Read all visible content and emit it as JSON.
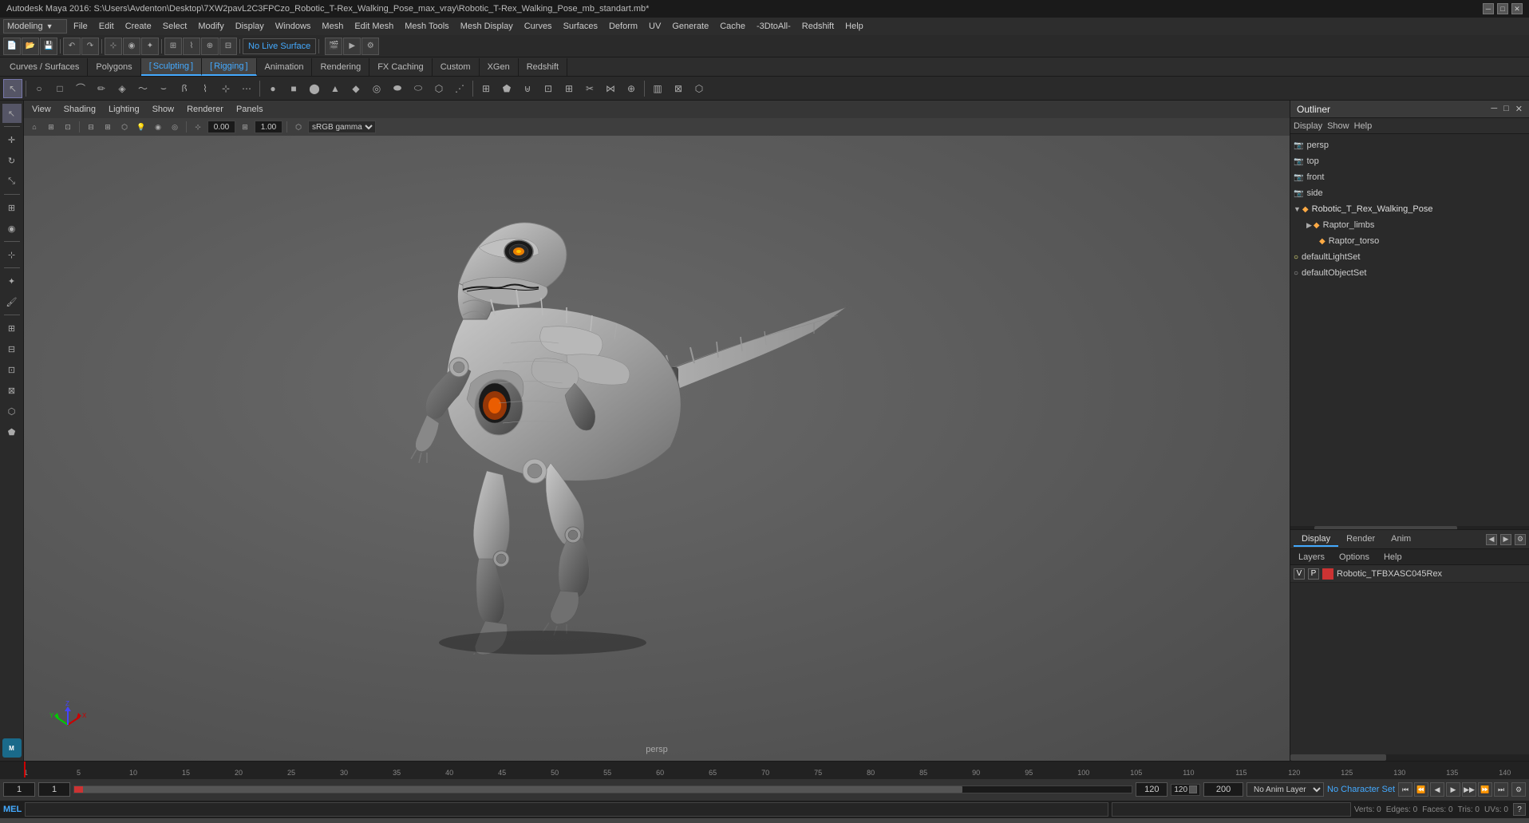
{
  "title": {
    "text": "Autodesk Maya 2016: S:\\Users\\Avdenton\\Desktop\\7XW2pavL2C3FPCzo_Robotic_T-Rex_Walking_Pose_max_vray\\Robotic_T-Rex_Walking_Pose_mb_standart.mb*",
    "app": "Autodesk Maya 2016"
  },
  "window_controls": {
    "minimize": "─",
    "maximize": "□",
    "close": "✕"
  },
  "workspace": "Modeling",
  "menu_bar": {
    "items": [
      "File",
      "Edit",
      "Modify",
      "Display",
      "Windows",
      "Mesh",
      "Edit Mesh",
      "Mesh Tools",
      "Mesh Display",
      "Curves",
      "Surfaces",
      "Deform",
      "UV",
      "Generate",
      "Cache",
      "-3DtoAll-",
      "Redshift",
      "Help"
    ]
  },
  "tabs": {
    "items": [
      {
        "label": "Curves / Surfaces",
        "active": false
      },
      {
        "label": "Polygons",
        "active": false
      },
      {
        "label": "Sculpting",
        "active": true
      },
      {
        "label": "Rigging",
        "active": true
      },
      {
        "label": "Animation",
        "active": false
      },
      {
        "label": "Rendering",
        "active": false
      },
      {
        "label": "FX Caching",
        "active": false
      },
      {
        "label": "Custom",
        "active": false
      },
      {
        "label": "XGen",
        "active": false
      },
      {
        "label": "Redshift",
        "active": false
      }
    ]
  },
  "toolbar": {
    "live_surface": "No Live Surface"
  },
  "viewport": {
    "menus": [
      "View",
      "Shading",
      "Lighting",
      "Show",
      "Renderer",
      "Panels"
    ],
    "camera": "persp",
    "value1": "0.00",
    "value2": "1.00",
    "color_mode": "sRGB gamma"
  },
  "outliner": {
    "title": "Outliner",
    "menus": [
      "Display",
      "Show",
      "Help"
    ],
    "items": [
      {
        "name": "persp",
        "type": "camera",
        "indent": 0,
        "icon": "▣"
      },
      {
        "name": "top",
        "type": "camera",
        "indent": 0,
        "icon": "▣"
      },
      {
        "name": "front",
        "type": "camera",
        "indent": 0,
        "icon": "▣"
      },
      {
        "name": "side",
        "type": "camera",
        "indent": 0,
        "icon": "▣"
      },
      {
        "name": "Robotic_T_Rex_Walking_Pose",
        "type": "mesh",
        "indent": 0,
        "icon": "◆"
      },
      {
        "name": "Raptor_limbs",
        "type": "mesh",
        "indent": 1,
        "icon": "◆"
      },
      {
        "name": "Raptor_torso",
        "type": "mesh",
        "indent": 2,
        "icon": "◆"
      },
      {
        "name": "defaultLightSet",
        "type": "set",
        "indent": 0,
        "icon": "○"
      },
      {
        "name": "defaultObjectSet",
        "type": "set",
        "indent": 0,
        "icon": "○"
      }
    ]
  },
  "render_panel": {
    "tabs": [
      "Display",
      "Render",
      "Anim"
    ],
    "active_tab": "Display",
    "sub_tabs": [
      "Layers",
      "Options",
      "Help"
    ],
    "layer_name": "Robotic_TFBXASC045Rex"
  },
  "timeline": {
    "start": "1",
    "end": "120",
    "current": "1",
    "range_start": "1",
    "range_end": "120",
    "max": "200",
    "ticks": [
      "1",
      "5",
      "10",
      "15",
      "20",
      "25",
      "30",
      "35",
      "40",
      "45",
      "50",
      "55",
      "60",
      "65",
      "70",
      "75",
      "80",
      "85",
      "90",
      "95",
      "100",
      "105",
      "110",
      "115",
      "120",
      "125",
      "130",
      "135",
      "140"
    ],
    "anim_layer": "No Anim Layer",
    "char_set": "No Character Set"
  },
  "status_bar": {
    "mel_label": "MEL",
    "mel_placeholder": "",
    "script_label": ""
  },
  "playback": {
    "btn_start": "⏮",
    "btn_prev_key": "⏪",
    "btn_prev": "◀",
    "btn_play": "▶",
    "btn_next": "▶▶",
    "btn_next_key": "⏩",
    "btn_end": "⏭"
  }
}
